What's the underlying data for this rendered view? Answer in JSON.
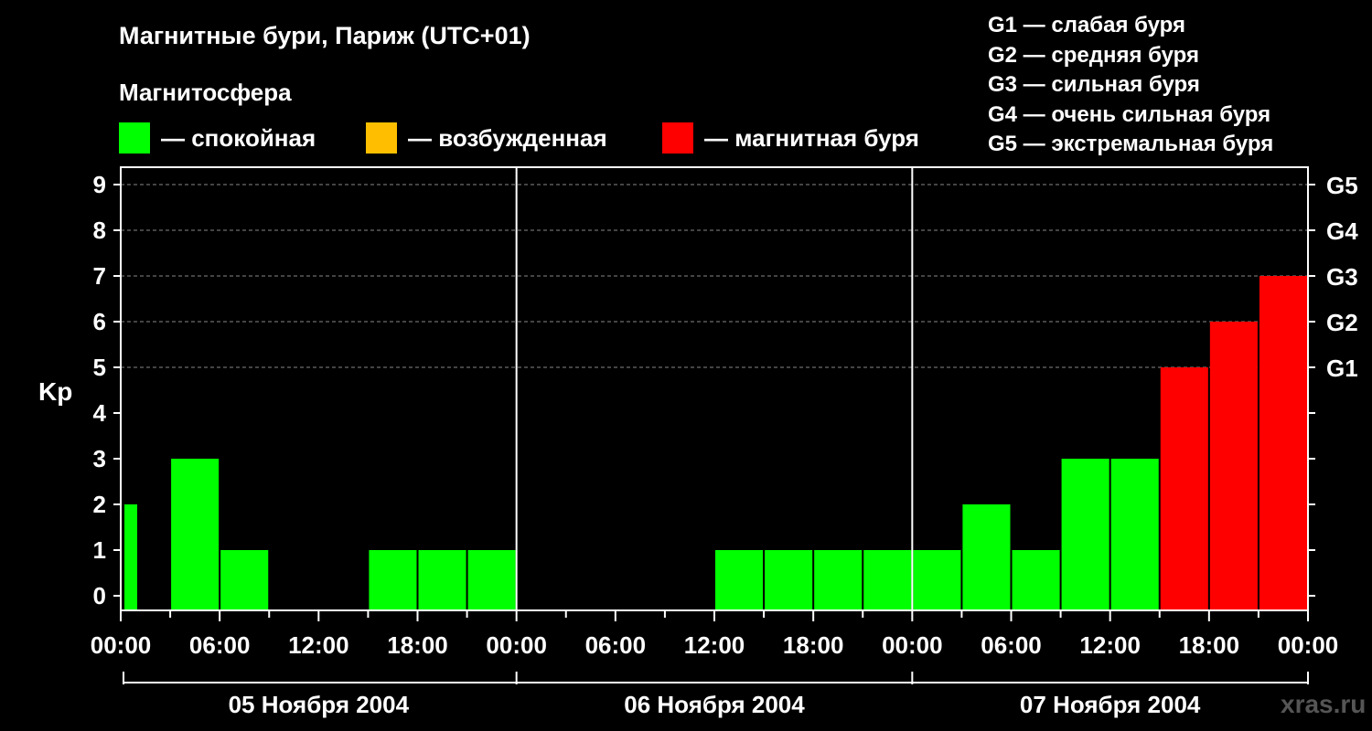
{
  "title": "Магнитные бури, Париж (UTC+01)",
  "subtitle": "Магнитосфера",
  "legend": [
    {
      "label": "— спокойная",
      "color": "#00ff00"
    },
    {
      "label": "— возбужденная",
      "color": "#ffbf00"
    },
    {
      "label": "— магнитная буря",
      "color": "#ff0000"
    }
  ],
  "g_legend": [
    "G1 — слабая буря",
    "G2 — средняя буря",
    "G3 — сильная буря",
    "G4 — очень сильная буря",
    "G5 — экстремальная буря"
  ],
  "watermark": "xras.ru",
  "chart_data": {
    "type": "bar",
    "ylabel": "Kp",
    "ylim": [
      0,
      9
    ],
    "yticks": [
      0,
      1,
      2,
      3,
      4,
      5,
      6,
      7,
      8,
      9
    ],
    "y2ticks": [
      {
        "kp": 5,
        "label": "G1"
      },
      {
        "kp": 6,
        "label": "G2"
      },
      {
        "kp": 7,
        "label": "G3"
      },
      {
        "kp": 8,
        "label": "G4"
      },
      {
        "kp": 9,
        "label": "G5"
      }
    ],
    "xtick_labels": [
      "00:00",
      "06:00",
      "12:00",
      "18:00",
      "00:00",
      "06:00",
      "12:00",
      "18:00",
      "00:00",
      "06:00",
      "12:00",
      "18:00",
      "00:00"
    ],
    "days": [
      "05 Ноября 2004",
      "06 Ноября 2004",
      "07 Ноября 2004"
    ],
    "bar_interval_hours": 3,
    "grid": "dashed horizontal at Kp 5-9",
    "series": [
      {
        "values": [
          2,
          3,
          1,
          0,
          0,
          1,
          1,
          1,
          0,
          0,
          0,
          0,
          1,
          1,
          1,
          1,
          1,
          2,
          1,
          3,
          3,
          5,
          6,
          7
        ]
      }
    ]
  }
}
